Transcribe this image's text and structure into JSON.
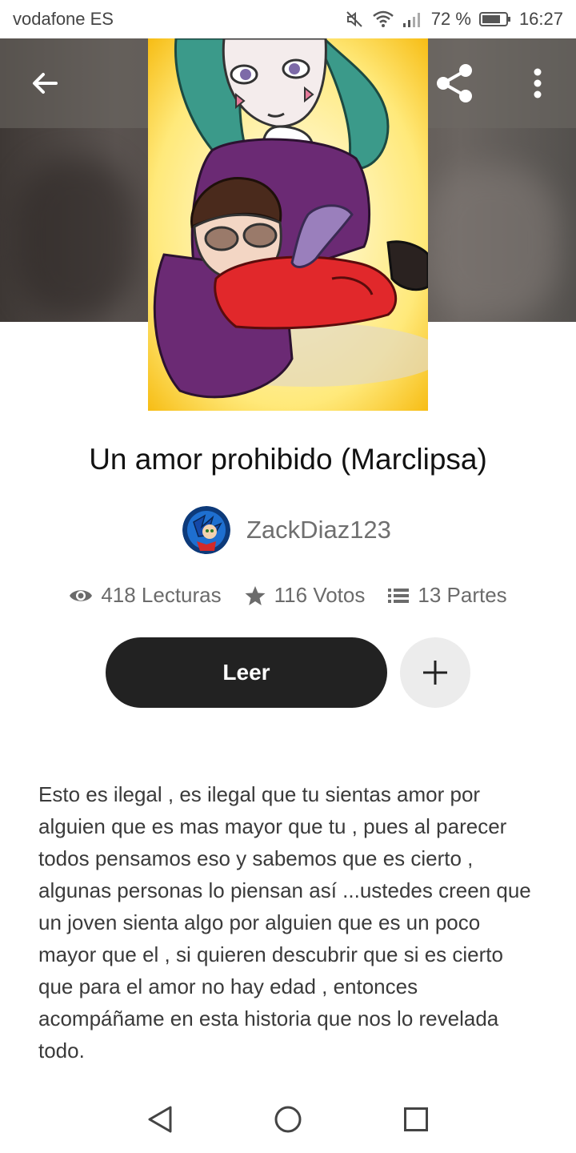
{
  "status_bar": {
    "carrier": "vodafone ES",
    "battery": "72 %",
    "time": "16:27",
    "icons": [
      "mute-icon",
      "wifi-icon",
      "signal-icon",
      "battery-icon"
    ]
  },
  "app_bar": {
    "icons": [
      "arrow-left-icon",
      "share-icon",
      "more-vertical-icon"
    ]
  },
  "story": {
    "title": "Un amor prohibido (Marclipsa)",
    "author": "ZackDiaz123",
    "stats": {
      "reads": "418 Lecturas",
      "votes": "116 Votos",
      "parts": "13 Partes"
    },
    "read_label": "Leer",
    "description": "Esto es ilegal , es ilegal que tu sientas amor por alguien que es mas mayor que tu , pues al parecer todos pensamos eso y sabemos que es cierto , algunas personas lo piensan así ...ustedes creen que un joven sienta algo por alguien que es un poco mayor que el  , si quieren descubrir que si es cierto que para el amor no hay edad , entonces acompáñame en esta historia que nos lo revelada todo."
  },
  "nav_bar": {
    "icons": [
      "back-triangle-icon",
      "home-circle-icon",
      "recents-square-icon"
    ]
  },
  "colors": {
    "primary_button": "#222222",
    "secondary_button": "#ececec",
    "text_dark": "#121212",
    "text_muted": "#6b6b6b"
  }
}
